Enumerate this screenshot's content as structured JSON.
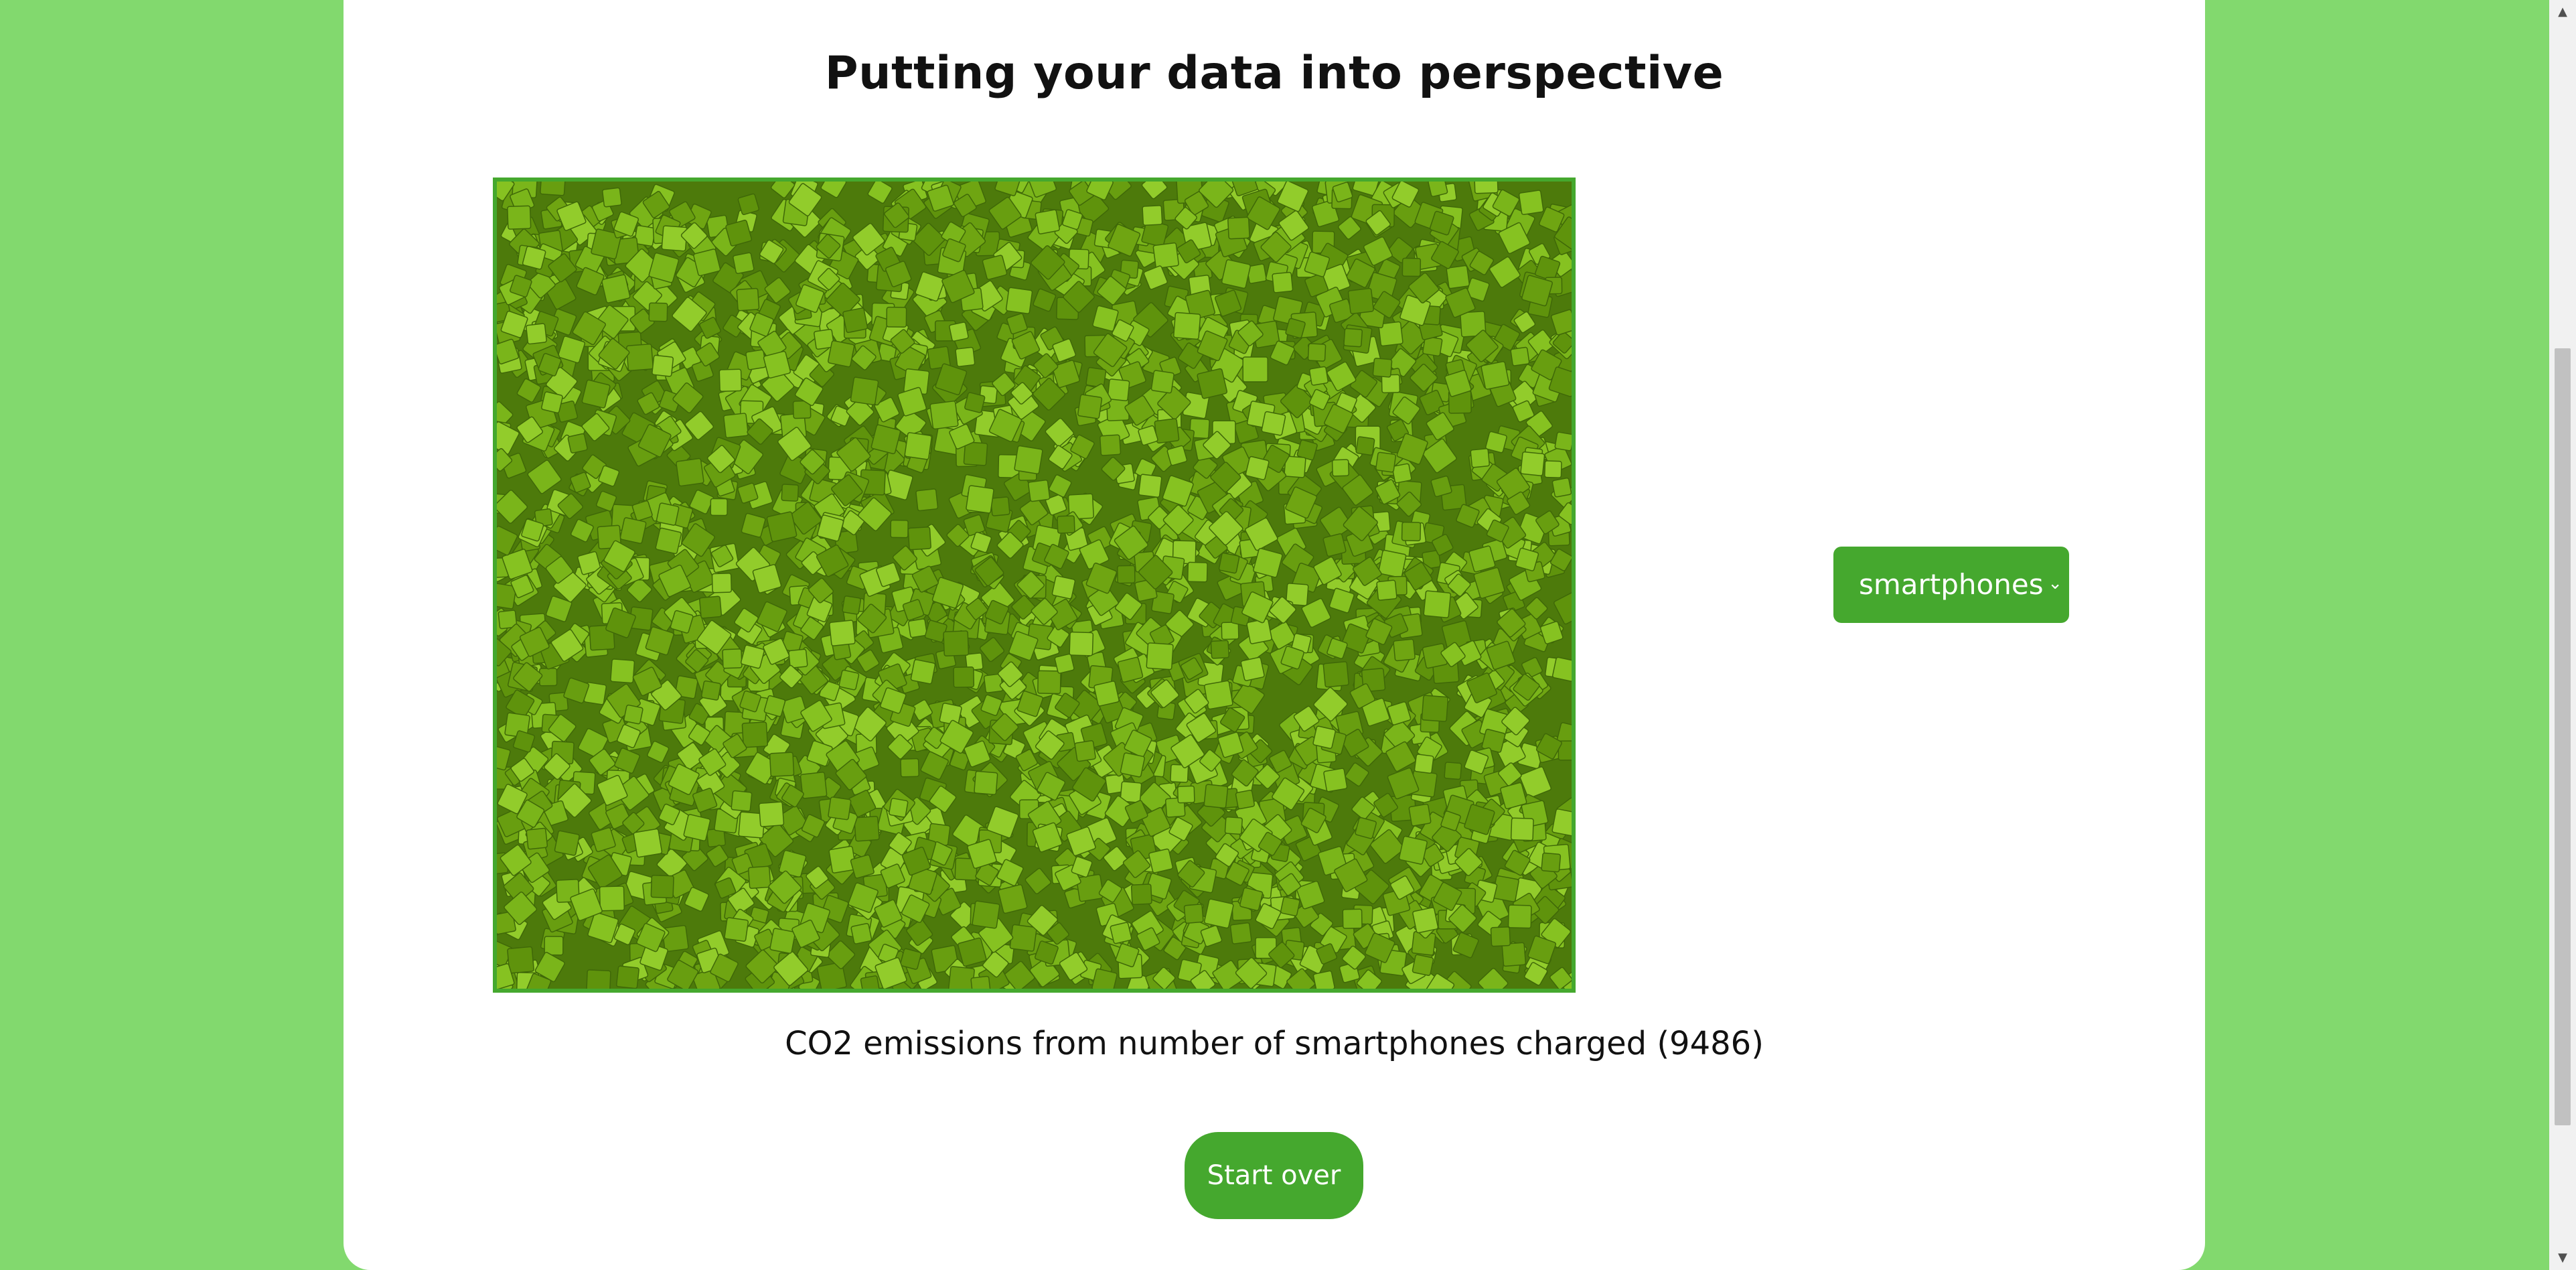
{
  "page": {
    "title": "Putting your data into perspective",
    "caption": "CO2 emissions from number of smartphones charged (9486)",
    "start_over_label": "Start over"
  },
  "comparison_select": {
    "selected": "smartphones",
    "chevron_icon": "chevron-down-icon"
  },
  "visualization": {
    "quantity": 9486,
    "fill_color": "#6fa512",
    "border_color": "#45a82e"
  },
  "scrollbar": {
    "up_icon": "▲",
    "down_icon": "▼"
  },
  "colors": {
    "background": "#82d96e",
    "accent": "#45a82e",
    "card": "#ffffff"
  }
}
